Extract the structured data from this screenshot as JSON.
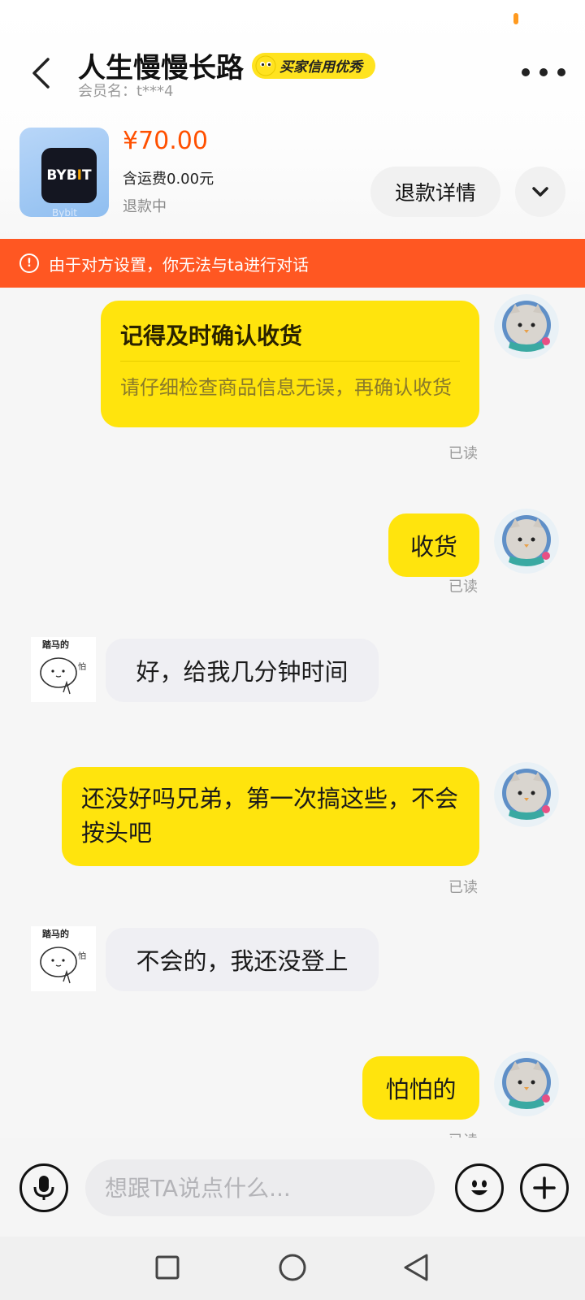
{
  "header": {
    "title": "人生慢慢长路",
    "credit_badge": "买家信用优秀",
    "member_label": "会员名：t***4"
  },
  "product": {
    "brand": "BYB",
    "brand_bar": "I",
    "brand_end": "T",
    "brand_footer": "Bybit",
    "price": "¥70.00",
    "shipping": "含运费0.00元",
    "status": "退款中",
    "refund_button": "退款详情"
  },
  "notice": {
    "text": "由于对方设置，你无法与ta进行对话",
    "color": "#ff5722"
  },
  "messages": [
    {
      "from": "me",
      "type": "card",
      "title": "记得及时确认收货",
      "body": "请仔细检查商品信息无误，再确认收货",
      "read": "已读"
    },
    {
      "from": "me",
      "type": "text",
      "text": "收货",
      "read": "已读"
    },
    {
      "from": "them",
      "type": "text",
      "text": "好，给我几分钟时间",
      "sticker_caption": "踏马的",
      "sticker_side": "怕"
    },
    {
      "from": "me",
      "type": "text",
      "text": "还没好吗兄弟，第一次搞这些，不会按头吧",
      "read": "已读"
    },
    {
      "from": "them",
      "type": "text",
      "text": "不会的，我还没登上",
      "sticker_caption": "踏马的",
      "sticker_side": "怕"
    },
    {
      "from": "me",
      "type": "text",
      "text": "怕怕的",
      "read": "已读"
    }
  ],
  "input": {
    "placeholder": "想跟TA说点什么..."
  },
  "icons": {
    "back": "chevron-left-icon",
    "more": "more-dots-icon",
    "expand": "chevron-down-icon",
    "notice": "alert-circle-icon",
    "voice": "microphone-icon",
    "emoji": "emoji-icon",
    "add": "plus-icon"
  },
  "colors": {
    "accent_yellow": "#ffe40d",
    "price_orange": "#ff5000"
  }
}
